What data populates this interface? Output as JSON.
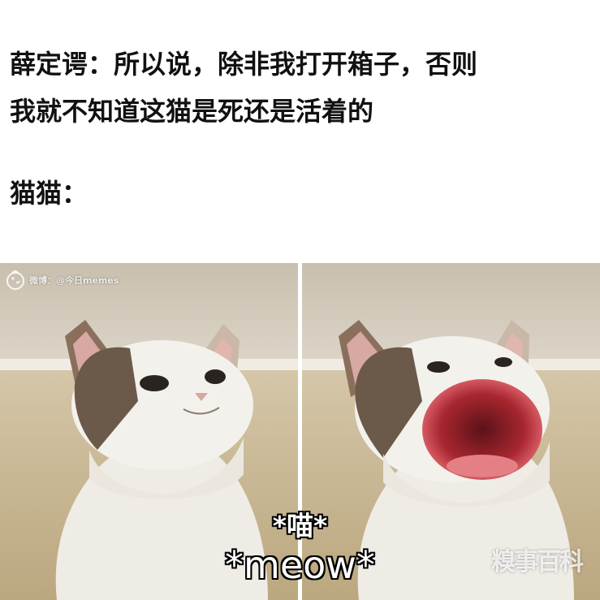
{
  "caption": {
    "line1": "薛定谔：所以说，除非我打开箱子，否则",
    "line2": "我就不知道这猫是死还是活着的",
    "line3": "猫猫："
  },
  "meme": {
    "panels": [
      {
        "id": "left",
        "mouth_state": "closed"
      },
      {
        "id": "right",
        "mouth_state": "open"
      }
    ],
    "subtitle_cn": "*喵*",
    "subtitle_en": "*meow*"
  },
  "watermarks": {
    "top_left": "微博：@今日memes",
    "bottom_right": "糗事百科"
  },
  "colors": {
    "background": "#ffffff",
    "caption_text": "#111111",
    "subtitle_text": "#ffffff",
    "subtitle_outline": "#000000",
    "wall": "#d9d1c4",
    "floor": "#c8b795",
    "cat_white": "#f3f1ec",
    "cat_patch": "#6b5a4a",
    "mouth": "#c0303a"
  }
}
